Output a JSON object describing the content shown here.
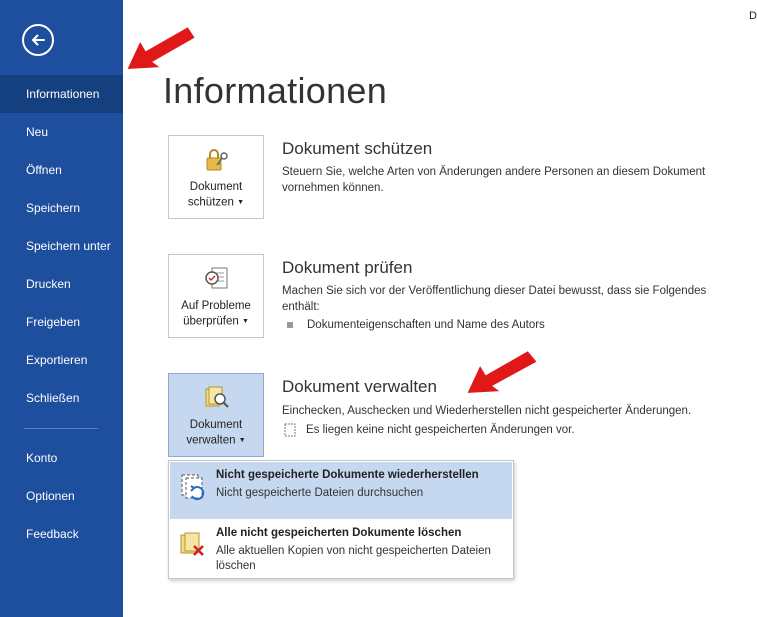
{
  "window": {
    "corner_text": "D"
  },
  "sidebar": {
    "items": [
      {
        "label": "Informationen",
        "active": true
      },
      {
        "label": "Neu"
      },
      {
        "label": "Öffnen"
      },
      {
        "label": "Speichern"
      },
      {
        "label": "Speichern unter"
      },
      {
        "label": "Drucken"
      },
      {
        "label": "Freigeben"
      },
      {
        "label": "Exportieren"
      },
      {
        "label": "Schließen"
      },
      {
        "label": "Konto"
      },
      {
        "label": "Optionen"
      },
      {
        "label": "Feedback"
      }
    ]
  },
  "page": {
    "title": "Informationen"
  },
  "sections": {
    "protect": {
      "button_line1": "Dokument",
      "button_line2": "schützen",
      "title": "Dokument schützen",
      "description": "Steuern Sie, welche Arten von Änderungen andere Personen an diesem Dokument vornehmen können."
    },
    "inspect": {
      "button_line1": "Auf Probleme",
      "button_line2": "überprüfen",
      "title": "Dokument prüfen",
      "description": "Machen Sie sich vor der Veröffentlichung dieser Datei bewusst, dass sie Folgendes enthält:",
      "bullet": "Dokumenteigenschaften und Name des Autors"
    },
    "manage": {
      "button_line1": "Dokument",
      "button_line2": "verwalten",
      "title": "Dokument verwalten",
      "description": "Einchecken, Auschecken und Wiederherstellen nicht gespeicherter Änderungen.",
      "status": "Es liegen keine nicht gespeicherten Änderungen vor."
    }
  },
  "dropdown": {
    "items": [
      {
        "title": "Nicht gespeicherte Dokumente wiederherstellen",
        "subtitle": "Nicht gespeicherte Dateien durchsuchen"
      },
      {
        "title": "Alle nicht gespeicherten Dokumente löschen",
        "subtitle": "Alle aktuellen Kopien von nicht gespeicherten Dateien löschen"
      }
    ]
  },
  "colors": {
    "sidebar": "#1e4e9e",
    "sidebar_active": "#14407f",
    "highlight": "#c5d8f0",
    "annotation_arrow": "#e01818"
  },
  "icons": [
    "back-arrow-icon",
    "lock-key-icon",
    "inspect-checklist-icon",
    "manage-document-icon",
    "recover-document-icon",
    "delete-document-icon",
    "document-small-icon"
  ]
}
